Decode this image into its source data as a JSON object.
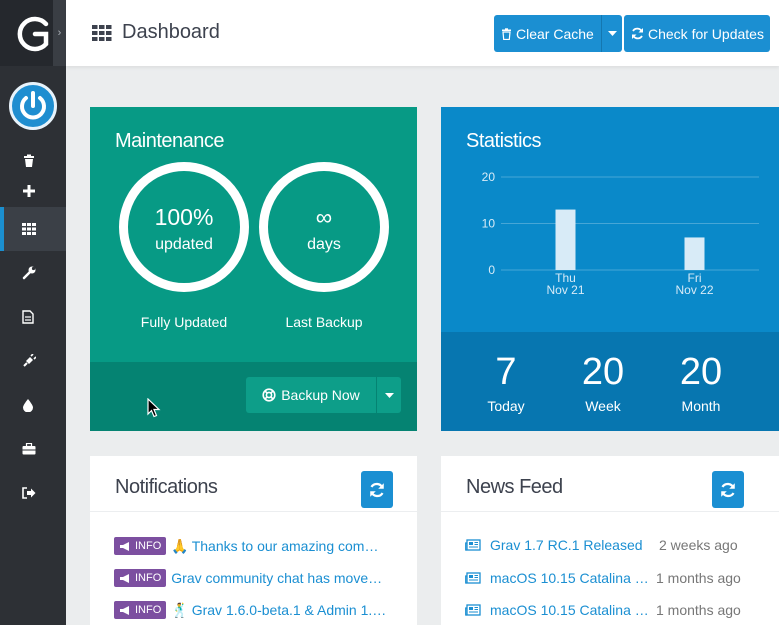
{
  "sidebar": {
    "collapse_glyph": "›",
    "items": [
      {
        "icon": "trash-icon"
      },
      {
        "icon": "plus-icon"
      },
      {
        "icon": "grid-icon",
        "active": true
      },
      {
        "icon": "wrench-icon"
      },
      {
        "icon": "file-icon"
      },
      {
        "icon": "plug-icon"
      },
      {
        "icon": "tint-icon"
      },
      {
        "icon": "briefcase-icon"
      },
      {
        "icon": "sign-out-icon"
      }
    ]
  },
  "header": {
    "title": "Dashboard",
    "clear_cache_label": "Clear Cache",
    "check_updates_label": "Check for Updates"
  },
  "maintenance": {
    "title": "Maintenance",
    "updated_value": "100%",
    "updated_unit": "updated",
    "updated_label": "Fully Updated",
    "backup_value": "∞",
    "backup_unit": "days",
    "backup_label": "Last Backup",
    "backup_button": "Backup Now"
  },
  "statistics": {
    "title": "Statistics",
    "today_value": "7",
    "today_label": "Today",
    "week_value": "20",
    "week_label": "Week",
    "month_value": "20",
    "month_label": "Month"
  },
  "chart_data": {
    "type": "bar",
    "categories": [
      "Thu Nov 21",
      "Fri Nov 22"
    ],
    "category_lines": [
      [
        "Thu",
        "Nov 21"
      ],
      [
        "Fri",
        "Nov 22"
      ]
    ],
    "values": [
      13,
      7
    ],
    "yticks": [
      0,
      10,
      20
    ],
    "ylim": [
      0,
      20
    ],
    "bar_color": "#d8ebf7"
  },
  "notifications": {
    "title": "Notifications",
    "items": [
      {
        "badge": "INFO",
        "emoji": "🙏",
        "text": "Thanks to our amazing com…"
      },
      {
        "badge": "INFO",
        "emoji": "",
        "text": "Grav community chat has move…"
      },
      {
        "badge": "INFO",
        "emoji": "🕺",
        "text": "Grav 1.6.0-beta.1 & Admin 1.…"
      }
    ]
  },
  "news": {
    "title": "News Feed",
    "items": [
      {
        "text": "Grav 1.7 RC.1 Released",
        "time": "2 weeks ago"
      },
      {
        "text": "macOS 10.15 Catalina …",
        "time": "1 months ago"
      },
      {
        "text": "macOS 10.15 Catalina …",
        "time": "1 months ago"
      }
    ]
  },
  "colors": {
    "sidebar": "#2d3035",
    "accent_blue": "#1b8fd2",
    "maintenance_green": "#079a85",
    "statistics_blue": "#0a89c9",
    "info_badge": "#7c4fa0"
  }
}
